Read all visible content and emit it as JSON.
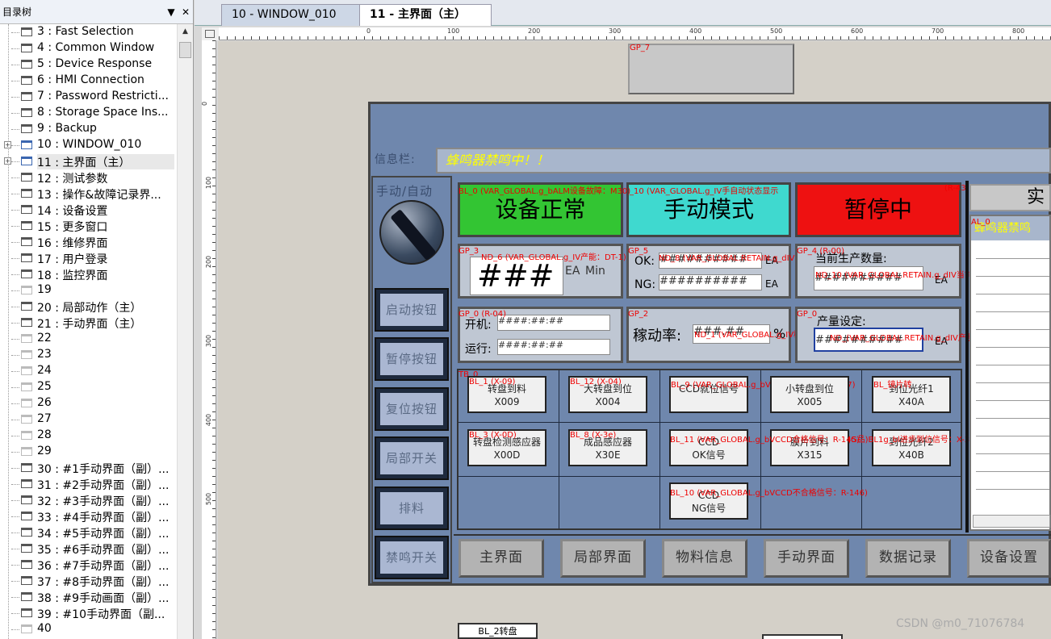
{
  "tree": {
    "title": "目录树",
    "pin": "▼",
    "close": "✕",
    "items": [
      {
        "label": "3 : Fast Selection",
        "exp": "",
        "icon": "win"
      },
      {
        "label": "4 : Common Window",
        "exp": "",
        "icon": "win"
      },
      {
        "label": "5 : Device Response",
        "exp": "",
        "icon": "win"
      },
      {
        "label": "6 : HMI Connection",
        "exp": "",
        "icon": "win"
      },
      {
        "label": "7 : Password Restricti...",
        "exp": "",
        "icon": "win"
      },
      {
        "label": "8 : Storage Space Ins...",
        "exp": "",
        "icon": "win"
      },
      {
        "label": "9 : Backup",
        "exp": "",
        "icon": "win"
      },
      {
        "label": "10 : WINDOW_010",
        "exp": "+",
        "icon": "blue"
      },
      {
        "label": "11 : 主界面（主）",
        "exp": "+",
        "icon": "blue",
        "selected": true
      },
      {
        "label": "12 : 测试参数",
        "exp": "",
        "icon": "win"
      },
      {
        "label": "13 : 操作&故障记录界...",
        "exp": "",
        "icon": "win"
      },
      {
        "label": "14 : 设备设置",
        "exp": "",
        "icon": "win"
      },
      {
        "label": "15 : 更多窗口",
        "exp": "",
        "icon": "win"
      },
      {
        "label": "16 : 维修界面",
        "exp": "",
        "icon": "win"
      },
      {
        "label": "17 : 用户登录",
        "exp": "",
        "icon": "win"
      },
      {
        "label": "18 : 监控界面",
        "exp": "",
        "icon": "win"
      },
      {
        "label": "19",
        "exp": "",
        "icon": "empty"
      },
      {
        "label": "20 : 局部动作（主）",
        "exp": "",
        "icon": "win"
      },
      {
        "label": "21 : 手动界面（主）",
        "exp": "",
        "icon": "win"
      },
      {
        "label": "22",
        "exp": "",
        "icon": "empty"
      },
      {
        "label": "23",
        "exp": "",
        "icon": "empty"
      },
      {
        "label": "24",
        "exp": "",
        "icon": "empty"
      },
      {
        "label": "25",
        "exp": "",
        "icon": "empty"
      },
      {
        "label": "26",
        "exp": "",
        "icon": "empty"
      },
      {
        "label": "27",
        "exp": "",
        "icon": "empty"
      },
      {
        "label": "28",
        "exp": "",
        "icon": "empty"
      },
      {
        "label": "29",
        "exp": "",
        "icon": "empty"
      },
      {
        "label": "30 : #1手动界面（副）...",
        "exp": "",
        "icon": "win"
      },
      {
        "label": "31 : #2手动界面（副）...",
        "exp": "",
        "icon": "win"
      },
      {
        "label": "32 : #3手动界面（副）...",
        "exp": "",
        "icon": "win"
      },
      {
        "label": "33 : #4手动界面（副）...",
        "exp": "",
        "icon": "win"
      },
      {
        "label": "34 : #5手动界面（副）...",
        "exp": "",
        "icon": "win"
      },
      {
        "label": "35 : #6手动界面（副）...",
        "exp": "",
        "icon": "win"
      },
      {
        "label": "36 : #7手动界面（副）...",
        "exp": "",
        "icon": "win"
      },
      {
        "label": "37 : #8手动界面（副）...",
        "exp": "",
        "icon": "win"
      },
      {
        "label": "38 : #9手动画面（副）...",
        "exp": "",
        "icon": "win"
      },
      {
        "label": "39 : #10手动界面（副...",
        "exp": "",
        "icon": "win"
      },
      {
        "label": "40",
        "exp": "",
        "icon": "empty"
      }
    ]
  },
  "tabs": {
    "nav": "◁",
    "items": [
      {
        "label": "10 - WINDOW_010"
      },
      {
        "label": "11 - 主界面（主）",
        "close": "✕"
      }
    ]
  },
  "ruler": {
    "h": [
      "0",
      "100",
      "200",
      "300",
      "400",
      "500",
      "600",
      "700",
      "800"
    ],
    "v": [
      "0",
      "100",
      "200",
      "300",
      "400",
      "500"
    ]
  },
  "labels": {
    "gp7": "GP_7",
    "info": "信息栏:",
    "info_text": "蜂鸣器禁鸣中！！",
    "mode": "手动/自动",
    "bl0": "BL_0 (VAR_GLOBAL.g_bALM设备故障：M30)",
    "bl10a": "_10 (VAR_GLOBAL.g_IV手自动状态显示",
    "r_top": "(R-43)4",
    "gp3": "GP_3",
    "nd6": "ND_6 (VAR_GLOBAL.g_IV产能：DT-1)",
    "gp5": "GP_5",
    "ndok": "ND_8 (VAR_GLOBAL.RETAIN.g_dIV合格数量：DT-250)",
    "gp_r00": "GP_4 (R-00)",
    "ndcur": "ND_10 (VAR_GLOBAL.RETAIN.g_dIV当前生产数量：DT-25",
    "gp0": "GP_0 (R-04)",
    "gp2": "GP_2",
    "gp0b": "GP_0",
    "nd1": "ND_1 (VAR_GLOBAL.g_IV稼动率：DT-",
    "ndset": "ND_(VAR_GLOBAL.RETAIN.g_dIV产量设定：DT-25000)",
    "bl11": "BL_11 (VAR_GLOBAL.g_bVCCD合格信号：R-145)",
    "bl11b": "(G品)BL1g_bl进步到位信号：X-315)",
    "bl10": "BL_10 (VAR_GLOBAL.g_bVCCD不合格信号：R-146)",
    "tb0": "TB_0",
    "al": "AL_0"
  },
  "status": {
    "normal": "设备正常",
    "manual": "手动模式",
    "pause": "暂停中",
    "real": "实"
  },
  "counts": {
    "speed": "###",
    "speed_unit": "Min",
    "speed_ea": "EA",
    "ok": "OK:",
    "ng": "NG:",
    "hash": "##########",
    "ea": "EA",
    "prod": "当前生产数量:",
    "setq": "产量设定:",
    "open": "开机:",
    "run": "运行:",
    "util": "稼动率:",
    "util_val": "###.##",
    "pct": "%",
    "hhmm": "####:##:##"
  },
  "leftbtns": [
    "启动按钮",
    "暂停按钮",
    "复位按钮",
    "局部开关",
    "排料",
    "禁鸣开关"
  ],
  "grid": [
    {
      "tag": "BL_1 (X-09)",
      "l1": "转盘到料",
      "l2": "X009"
    },
    {
      "tag": "BL_12 (X-04)",
      "l1": "大转盘到位",
      "l2": "X004"
    },
    {
      "tag": "BL_9 (VAR_GLOBAL.g_bVCCD就位信号：R-147)",
      "l1": "CCD就位信号",
      "l2": ""
    },
    {
      "tag": "",
      "l1": "小转盘到位",
      "l2": "X005"
    },
    {
      "tag": "BL_镜片转",
      "l1": "到位光纤1",
      "l2": "X40A"
    },
    {
      "tag": "BL_3 (X-0D)",
      "l1": "转盘检测感应器",
      "l2": "X00D"
    },
    {
      "tag": "BL_8 (X-3e)",
      "l1": "成品感应器",
      "l2": "X30E"
    },
    {
      "tag": "",
      "l1": "CCD",
      "l2": "OK信号"
    },
    {
      "tag": "",
      "l1": "膜片到料",
      "l2": "X315"
    },
    {
      "tag": "",
      "l1": "到位光纤2",
      "l2": "X40B"
    },
    {
      "tag": "",
      "l1": "CCD",
      "l2": "NG信号"
    }
  ],
  "navbtns": [
    "主界面",
    "局部界面",
    "物料信息",
    "手动界面",
    "数据记录",
    "设备设置"
  ],
  "alarm": {
    "text": "蜂鸣器禁鸣"
  },
  "bottom": {
    "bl2": "BL_2转盘",
    "watermark": "CSDN @m0_71076784"
  },
  "colors": {
    "green": "#33c533",
    "cyan": "#3fd9cf",
    "red": "#ee1111"
  }
}
